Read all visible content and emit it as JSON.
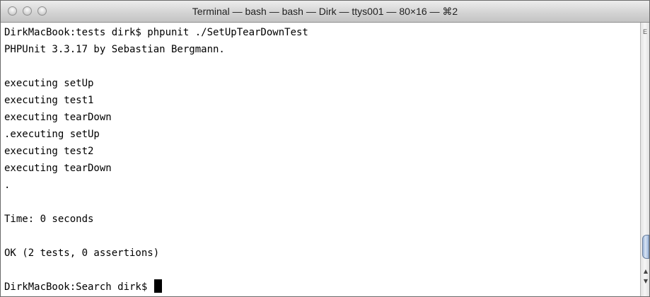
{
  "window": {
    "title": "Terminal — bash — bash — Dirk — ttys001 — 80×16 — ⌘2",
    "traffic_lights": [
      "close",
      "minimize",
      "zoom"
    ]
  },
  "terminal": {
    "lines": [
      "DirkMacBook:tests dirk$ phpunit ./SetUpTearDownTest",
      "PHPUnit 3.3.17 by Sebastian Bergmann.",
      "",
      "executing setUp",
      "executing test1",
      "executing tearDown",
      ".executing setUp",
      "executing test2",
      "executing tearDown",
      ".",
      "",
      "Time: 0 seconds",
      "",
      "OK (2 tests, 0 assertions)",
      "",
      "DirkMacBook:Search dirk$ "
    ],
    "cursor": "block"
  },
  "scrollbar": {
    "edge_glyph": "E",
    "up_arrow": "▲",
    "down_arrow": "▼"
  },
  "colors": {
    "background": "#ffffff",
    "text": "#000000",
    "titlebar": "#d2d2d2"
  }
}
